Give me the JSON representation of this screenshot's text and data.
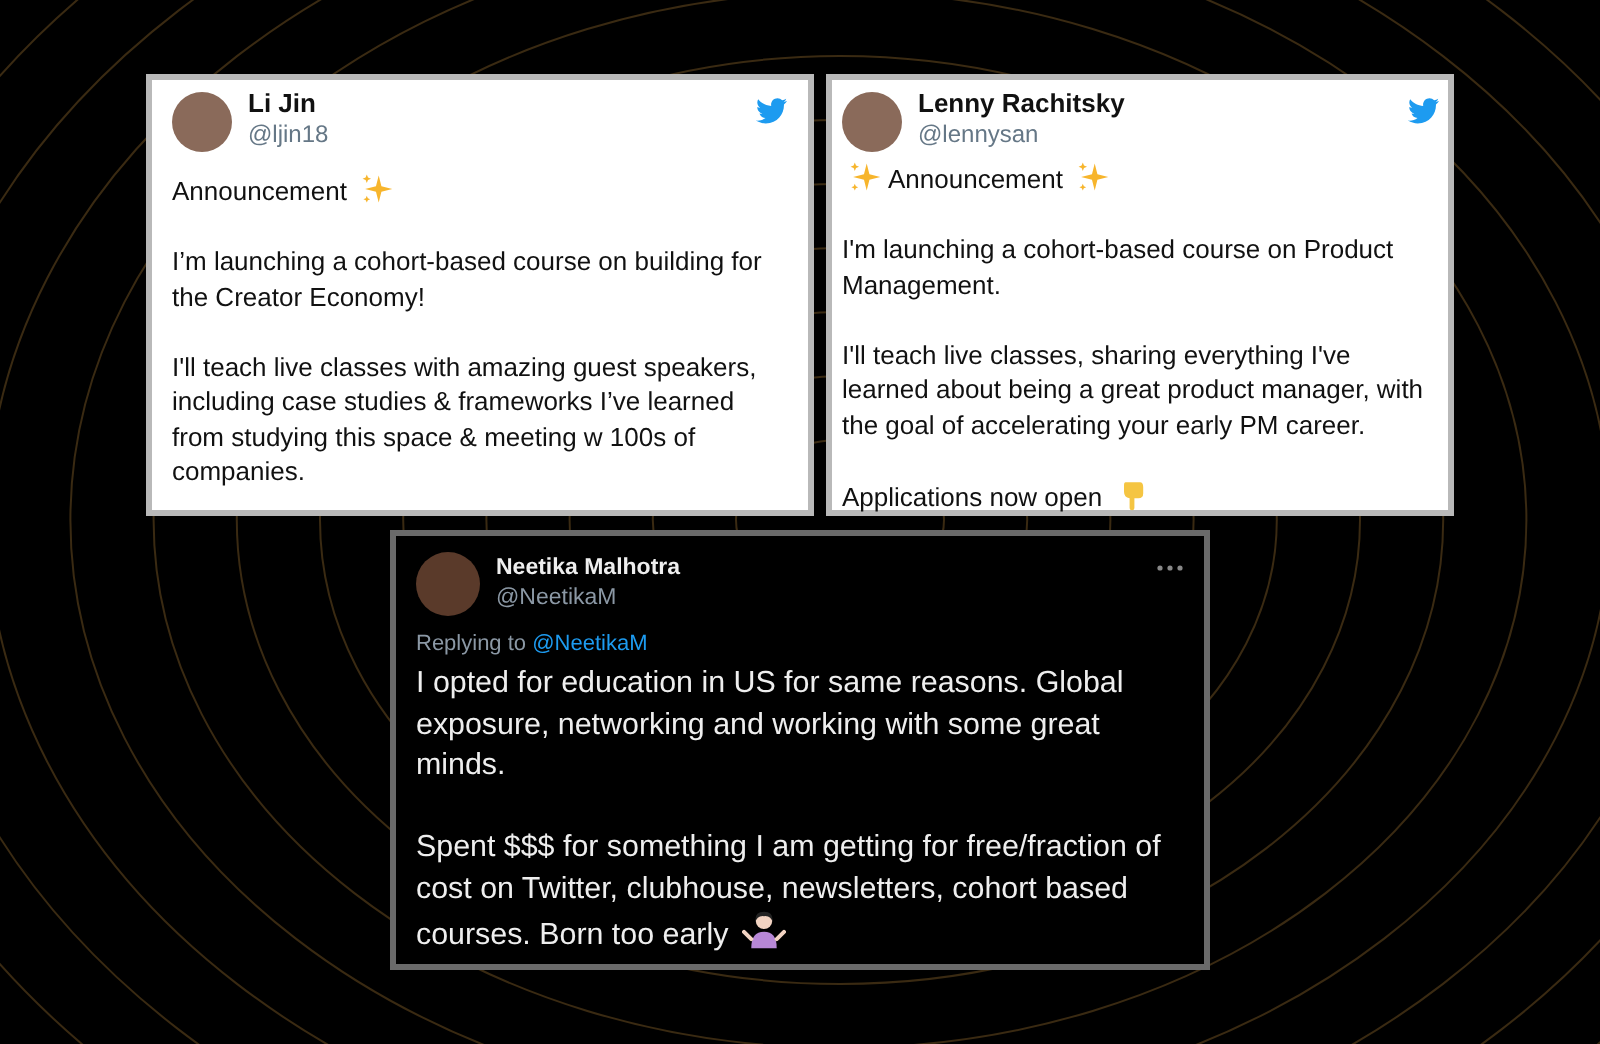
{
  "tweets": [
    {
      "kind": "light",
      "name": "Li Jin",
      "handle": "@ljin18",
      "paragraphs": [
        {
          "text": "Announcement",
          "kind": "sparkles-after"
        },
        {
          "text": "I’m launching a cohort-based course on building for the Creator Economy!",
          "kind": "plain"
        },
        {
          "text": "I'll teach live classes with amazing guest speakers, including case studies & frameworks I’ve learned from studying this space & meeting w 100s of companies.",
          "kind": "plain"
        }
      ]
    },
    {
      "kind": "light",
      "name": "Lenny Rachitsky",
      "handle": "@lennysan",
      "paragraphs": [
        {
          "text": "Announcement",
          "kind": "sparkles-both"
        },
        {
          "text": "I'm launching a cohort-based course on Product Management.",
          "kind": "plain"
        },
        {
          "text": "I'll teach live classes, sharing everything I've learned about being a great product manager, with the goal of accelerating your early PM career.",
          "kind": "plain"
        },
        {
          "text": "Applications now open",
          "kind": "point-after"
        }
      ]
    },
    {
      "kind": "dark",
      "name": "Neetika Malhotra",
      "handle": "@NeetikaM",
      "replying_to": {
        "label": "Replying to",
        "user": "@NeetikaM"
      },
      "paragraphs": [
        {
          "text": "I opted for education in US for same reasons. Global exposure, networking and working with some great minds.",
          "kind": "plain"
        },
        {
          "text": "Spent $$$ for something I am getting for free/fraction of cost on Twitter, clubhouse, newsletters, cohort based courses. Born too early",
          "kind": "shrug-after"
        }
      ]
    }
  ]
}
